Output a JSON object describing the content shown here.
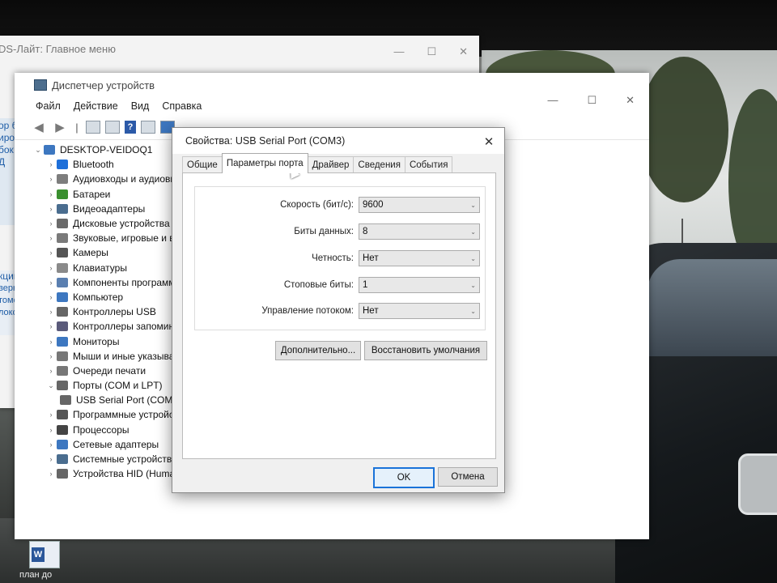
{
  "pds_window": {
    "title": "DS-Лайт: Главное меню",
    "side_text_1": [
      "ор бл",
      "ирова",
      "бок и Д"
    ],
    "side_header": "кции",
    "side_text_2": [
      "верка",
      "томоби",
      "локо"
    ]
  },
  "device_manager": {
    "title": "Диспетчер устройств",
    "menu": [
      "Файл",
      "Действие",
      "Вид",
      "Справка"
    ],
    "root": "DESKTOP-VEIDOQ1",
    "nodes": [
      {
        "label": "Bluetooth",
        "color": "#1e6fd9"
      },
      {
        "label": "Аудиовходы и аудиовы",
        "color": "#7d7d7d"
      },
      {
        "label": "Батареи",
        "color": "#3a8f2f"
      },
      {
        "label": "Видеоадаптеры",
        "color": "#4a6d8f"
      },
      {
        "label": "Дисковые устройства",
        "color": "#6a6a6a"
      },
      {
        "label": "Звуковые, игровые и в",
        "color": "#7a7a7a"
      },
      {
        "label": "Камеры",
        "color": "#555"
      },
      {
        "label": "Клавиатуры",
        "color": "#8a8a8a"
      },
      {
        "label": "Компоненты программ",
        "color": "#5a7fb0"
      },
      {
        "label": "Компьютер",
        "color": "#3d77c0"
      },
      {
        "label": "Контроллеры USB",
        "color": "#666"
      },
      {
        "label": "Контроллеры запомин",
        "color": "#5a5a7a"
      },
      {
        "label": "Мониторы",
        "color": "#3d77c0"
      },
      {
        "label": "Мыши и иные указыва",
        "color": "#777"
      },
      {
        "label": "Очереди печати",
        "color": "#777"
      },
      {
        "label": "Порты (COM и LPT)",
        "color": "#666"
      }
    ],
    "child": "USB Serial Port (COM",
    "nodes_after": [
      {
        "label": "Программные устройс",
        "color": "#555"
      },
      {
        "label": "Процессоры",
        "color": "#444"
      },
      {
        "label": "Сетевые адаптеры",
        "color": "#3d77c0"
      },
      {
        "label": "Системные устройства",
        "color": "#4a6d8f"
      },
      {
        "label": "Устройства HID (Huma",
        "color": "#666"
      }
    ]
  },
  "dialog": {
    "title": "Свойства: USB Serial Port (COM3)",
    "tabs": [
      "Общие",
      "Параметры порта",
      "Драйвер",
      "Сведения",
      "События"
    ],
    "active_tab": "Параметры порта",
    "fields": [
      {
        "label": "Скорость (бит/с):",
        "value": "9600"
      },
      {
        "label": "Биты данных:",
        "value": "8"
      },
      {
        "label": "Четность:",
        "value": "Нет"
      },
      {
        "label": "Стоповые биты:",
        "value": "1"
      },
      {
        "label": "Управление потоком:",
        "value": "Нет"
      }
    ],
    "advanced_button": "Дополнительно...",
    "restore_button": "Восстановить умолчания",
    "ok_button": "OK",
    "cancel_button": "Отмена"
  },
  "taskbar": {
    "word_label": "план до"
  }
}
